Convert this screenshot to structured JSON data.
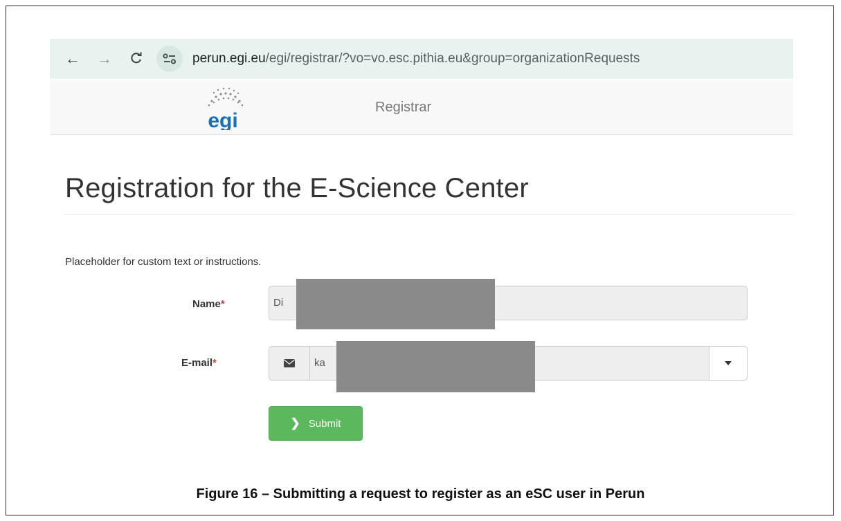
{
  "browser": {
    "back_glyph": "←",
    "forward_glyph": "→",
    "reload_glyph": "C",
    "url_host": "perun.egi.eu",
    "url_path": "/egi/registrar/?vo=vo.esc.pithia.eu&group=organizationRequests",
    "site_icon": "tune-icon"
  },
  "app": {
    "logo_text": "egi",
    "title": "Registrar"
  },
  "form": {
    "heading": "Registration for the E-Science Center",
    "instructions": "Placeholder for custom text or instructions.",
    "name": {
      "label": "Name",
      "required": "*",
      "value": "Di"
    },
    "email": {
      "label": "E-mail",
      "required": "*",
      "value": "ka"
    },
    "submit_label": "Submit",
    "submit_chevron": "❯"
  },
  "caption": "Figure 16 – Submitting a request to register as an eSC user in Perun",
  "colors": {
    "submit": "#5cb85c",
    "browser_bar": "#e8f3ef",
    "logo_blue": "#1a6fb5"
  }
}
